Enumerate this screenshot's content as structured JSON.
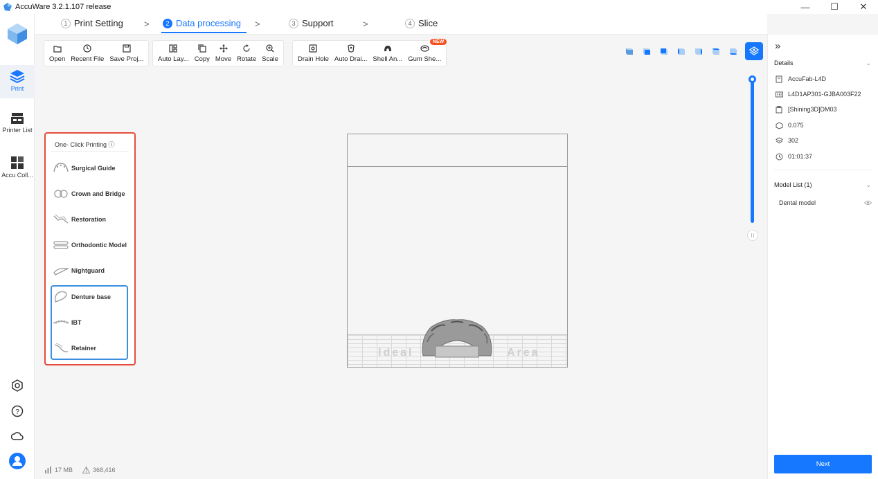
{
  "window": {
    "title": "AccuWare 3.2.1.107 release",
    "controls": [
      "—",
      "☐",
      "✕"
    ]
  },
  "rail": {
    "items": [
      {
        "label": "Print",
        "icon": "print-layers-icon"
      },
      {
        "label": "Printer List",
        "icon": "printer-icon"
      },
      {
        "label": "Accu Coll...",
        "icon": "collection-grid-icon"
      }
    ],
    "bottom_icons": [
      "settings-icon",
      "help-icon",
      "cloud-icon",
      "user-avatar-icon"
    ]
  },
  "steps": [
    {
      "num": "1",
      "label": "Print Setting"
    },
    {
      "num": "2",
      "label": "Data processing"
    },
    {
      "num": "3",
      "label": "Support"
    },
    {
      "num": "4",
      "label": "Slice"
    }
  ],
  "step_separator": ">",
  "toolbar": {
    "file": [
      {
        "label": "Open",
        "icon": "folder-icon"
      },
      {
        "label": "Recent File",
        "icon": "clock-icon"
      },
      {
        "label": "Save Proj...",
        "icon": "save-icon"
      }
    ],
    "edit": [
      {
        "label": "Auto Lay...",
        "icon": "auto-layout-icon"
      },
      {
        "label": "Copy",
        "icon": "copy-icon"
      },
      {
        "label": "Move",
        "icon": "move-icon"
      },
      {
        "label": "Rotate",
        "icon": "rotate-icon"
      },
      {
        "label": "Scale",
        "icon": "scale-icon"
      }
    ],
    "tools": [
      {
        "label": "Drain Hole",
        "icon": "drain-hole-icon"
      },
      {
        "label": "Auto Drai...",
        "icon": "auto-drain-icon"
      },
      {
        "label": "Shell An...",
        "icon": "shell-icon"
      },
      {
        "label": "Gum She...",
        "icon": "gum-shell-icon",
        "badge": "NEW"
      }
    ]
  },
  "viewbar": [
    "view-iso-icon",
    "view-front-icon",
    "view-back-icon",
    "view-left-icon",
    "view-right-icon",
    "view-top-icon",
    "view-bottom-icon",
    "view-model-icon"
  ],
  "one_click": {
    "title": "One- Click Printing ⓘ",
    "items": [
      {
        "label": "Surgical Guide",
        "icon": "surgical-guide-icon"
      },
      {
        "label": "Crown and Bridge",
        "icon": "crown-bridge-icon"
      },
      {
        "label": "Restoration",
        "icon": "restoration-icon"
      },
      {
        "label": "Orthodontic Model",
        "icon": "orthodontic-model-icon"
      },
      {
        "label": "Nightguard",
        "icon": "nightguard-icon"
      },
      {
        "label": "Denture base",
        "icon": "denture-base-icon"
      },
      {
        "label": "IBT",
        "icon": "ibt-icon"
      },
      {
        "label": "Retainer",
        "icon": "retainer-icon"
      }
    ]
  },
  "viewport": {
    "watermark_left": "Ideal",
    "watermark_right": "Area"
  },
  "right_panel": {
    "collapse_glyph": "»",
    "details_title": "Details",
    "details": [
      {
        "icon": "printer-model-icon",
        "text": "AccuFab-L4D"
      },
      {
        "icon": "serial-icon",
        "text": "L4D1AP301-GJBA003F22"
      },
      {
        "icon": "resin-icon",
        "text": "[Shining3D]DM03"
      },
      {
        "icon": "layer-thickness-icon",
        "text": "0.075"
      },
      {
        "icon": "layers-count-icon",
        "text": "302"
      },
      {
        "icon": "time-icon",
        "text": "01:01:37"
      }
    ],
    "model_list_title": "Model List (1)",
    "models": [
      {
        "name": "Dental model"
      }
    ],
    "next_label": "Next"
  },
  "status": {
    "memory": "17 MB",
    "triangles": "368,416"
  },
  "colors": {
    "accent": "#1677ff",
    "highlight_red": "#e74c3c",
    "highlight_blue": "#3b8fe0",
    "badge": "#f4511e"
  }
}
